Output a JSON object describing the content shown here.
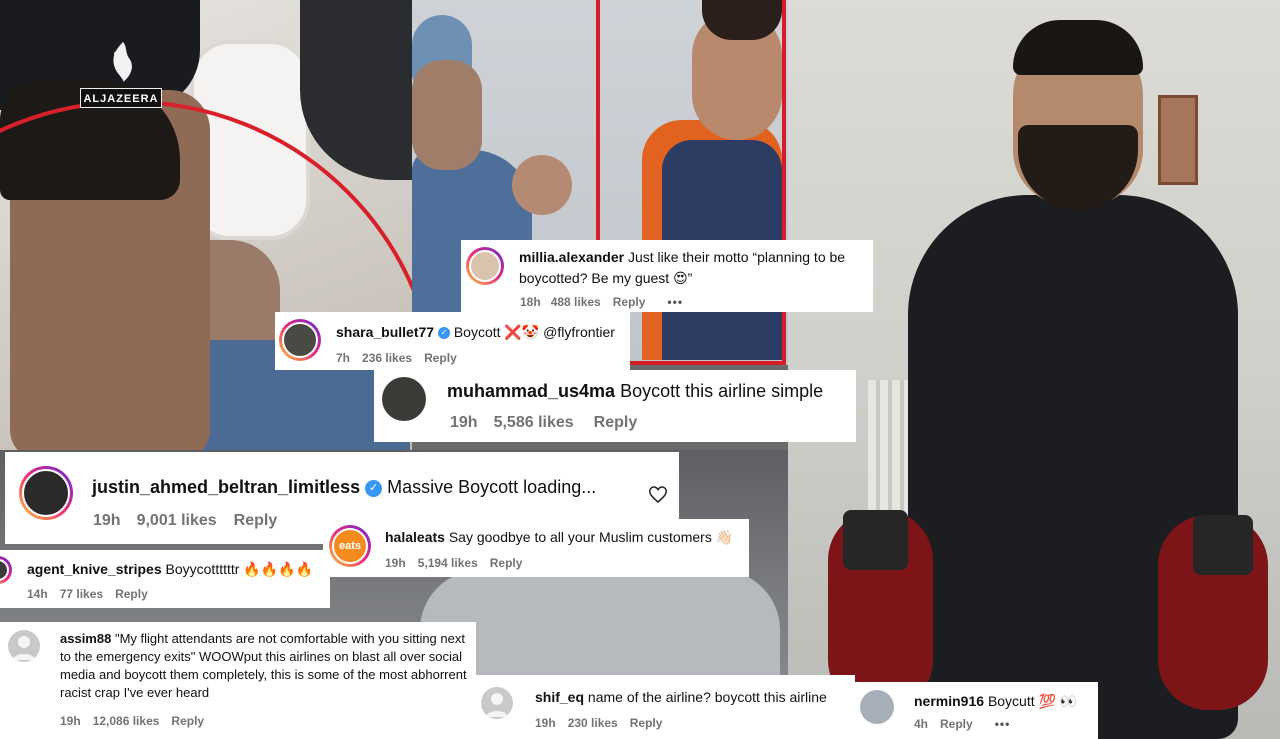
{
  "watermark": {
    "logo_text": "ALJAZEERA"
  },
  "comments": {
    "millia": {
      "username": "millia.alexander",
      "text": "Just like their motto “planning to be boycotted? Be my guest 😍”",
      "time": "18h",
      "likes": "488 likes",
      "reply": "Reply",
      "more": "•••"
    },
    "shara": {
      "username": "shara_bullet77",
      "text": "Boycott ❌🤡 @flyfrontier",
      "time": "7h",
      "likes": "236 likes",
      "reply": "Reply"
    },
    "muhammad": {
      "username": "muhammad_us4ma",
      "text": "Boycott this airline simple",
      "time": "19h",
      "likes": "5,586 likes",
      "reply": "Reply"
    },
    "justin": {
      "username": "justin_ahmed_beltran_limitless",
      "text": "Massive Boycott loading...",
      "time": "19h",
      "likes": "9,001 likes",
      "reply": "Reply"
    },
    "halal": {
      "username": "halaleats",
      "text": "Say goodbye to all your Muslim customers 👋🏻",
      "time": "19h",
      "likes": "5,194 likes",
      "reply": "Reply",
      "avatar_text": "eats"
    },
    "agent": {
      "username": "agent_knive_stripes",
      "text": "Boyycottttttr 🔥🔥🔥🔥",
      "time": "14h",
      "likes": "77 likes",
      "reply": "Reply"
    },
    "assim": {
      "username": "assim88",
      "text": "\"My flight attendants are not comfortable with you sitting next to the emergency exits\" WOOWput this airlines on blast all over social media and boycott them completely, this is some of the most abhorrent racist crap I've ever heard",
      "time": "19h",
      "likes": "12,086 likes",
      "reply": "Reply"
    },
    "shif": {
      "username": "shif_eq",
      "text": "name of the airline? boycott this airline",
      "time": "19h",
      "likes": "230 likes",
      "reply": "Reply"
    },
    "nermin": {
      "username": "nermin916",
      "text": "Boycutt 💯 👀",
      "time": "4h",
      "reply": "Reply",
      "more": "•••"
    }
  },
  "icons": [
    "heart-icon",
    "verified-badge-icon",
    "more-options-icon",
    "default-avatar-icon"
  ],
  "colors": {
    "link_blue": "#3897f0",
    "meta_gray": "#737373",
    "highlight_red": "#d51d27"
  }
}
